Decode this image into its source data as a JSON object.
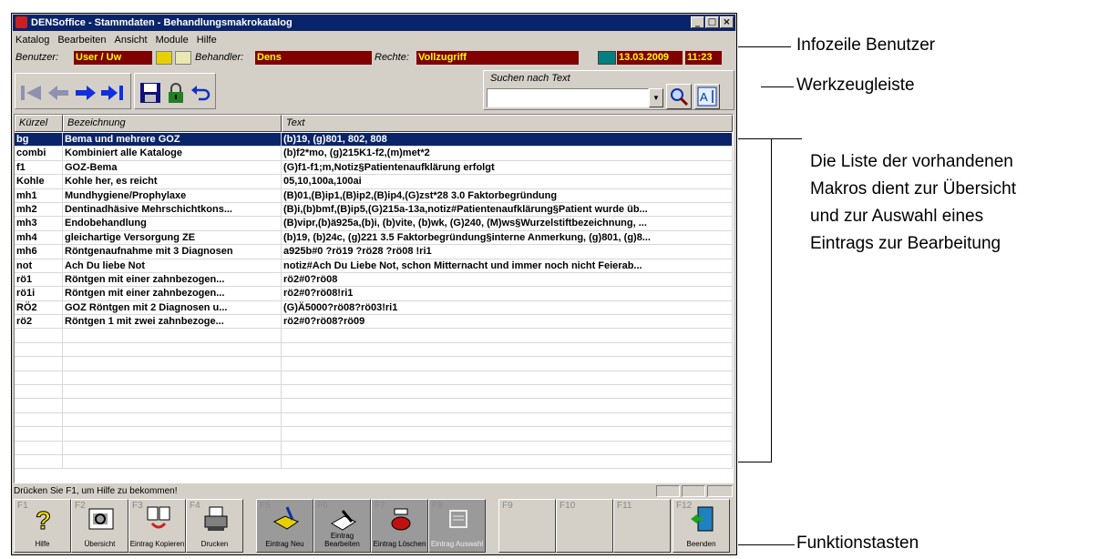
{
  "window": {
    "title": "DENSoffice - Stammdaten - Behandlungsmakrokatalog",
    "controls": [
      "_",
      "□",
      "×"
    ]
  },
  "menu": [
    "Katalog",
    "Bearbeiten",
    "Ansicht",
    "Module",
    "Hilfe"
  ],
  "infobar": {
    "benutzer_label": "Benutzer:",
    "benutzer_value": "User / Uw",
    "behandler_label": "Behandler:",
    "behandler_value": "Dens",
    "rechte_label": "Rechte:",
    "rechte_value": "Vollzugriff",
    "date": "13.03.2009",
    "time": "11:23"
  },
  "toolbar": {
    "search_label": "Suchen nach Text",
    "search_value": ""
  },
  "grid": {
    "columns": [
      "Kürzel",
      "Bezeichnung",
      "Text"
    ],
    "rows": [
      [
        "bg",
        "Bema und mehrere GOZ",
        "(b)19, (g)801, 802, 808"
      ],
      [
        "combi",
        "Kombiniert alle Kataloge",
        "(b)f2*mo, (g)215K1-f2,(m)met*2"
      ],
      [
        "f1",
        "GOZ-Bema",
        "(G)f1-f1;m,Notiz§Patientenaufklärung erfolgt"
      ],
      [
        "Kohle",
        "Kohle her, es reicht",
        "05,10,100a,100ai"
      ],
      [
        "mh1",
        "Mundhygiene/Prophylaxe",
        "(B)01,(B)ip1,(B)ip2,(B)ip4,(G)zst*28 3.0 Faktorbegründung"
      ],
      [
        "mh2",
        "Dentinadhäsive Mehrschichtkons...",
        "(B)i,(b)bmf,(B)ip5,(G)215a-13a,notiz#Patientenaufklärung§Patient wurde üb..."
      ],
      [
        "mh3",
        "Endobehandlung",
        "(B)vipr,(b)ä925a,(b)i, (b)vite, (b)wk, (G)240, (M)ws§Wurzelstiftbezeichnung, ..."
      ],
      [
        "mh4",
        "gleichartige Versorgung ZE",
        "(b)19, (b)24c, (g)221 3.5 Faktorbegründung§interne Anmerkung, (g)801, (g)8..."
      ],
      [
        "mh6",
        "Röntgenaufnahme mit 3 Diagnosen",
        "a925b#0 ?rö19 ?rö28  ?rö08 !ri1"
      ],
      [
        "not",
        "Ach Du liebe Not",
        "notiz#Ach Du Liebe Not, schon Mitternacht und immer noch nicht Feierab..."
      ],
      [
        "rö1",
        "Röntgen mit einer zahnbezogen...",
        "rö2#0?rö08"
      ],
      [
        "rö1i",
        "Röntgen mit einer zahnbezogen...",
        "rö2#0?rö08!ri1"
      ],
      [
        "RÖ2",
        "GOZ Röntgen mit 2 Diagnosen u...",
        "(G)Ä5000?rö08?rö03!ri1"
      ],
      [
        "rö2",
        "Röntgen 1 mit zwei zahnbezoge...",
        "rö2#0?rö08?rö09"
      ]
    ],
    "empty_rows": 10
  },
  "status": {
    "text": "Drücken Sie F1, um Hilfe zu bekommen!"
  },
  "fkeys": [
    {
      "num": "F1",
      "label": "Hilfe",
      "icon": "help-icon"
    },
    {
      "num": "F2",
      "label": "Übersicht",
      "icon": "overview-icon"
    },
    {
      "num": "F3",
      "label": "Eintrag Kopieren",
      "icon": "copy-icon"
    },
    {
      "num": "F4",
      "label": "Drucken",
      "icon": "printer-icon"
    },
    {
      "num": "F5",
      "label": "Eintrag Neu",
      "icon": "new-entry-icon"
    },
    {
      "num": "F6",
      "label": "Eintrag Bearbeiten",
      "icon": "edit-icon"
    },
    {
      "num": "F7",
      "label": "Eintrag Löschen",
      "icon": "delete-icon"
    },
    {
      "num": "F8",
      "label": "Eintrag Auswahl",
      "icon": "select-icon"
    },
    {
      "num": "F9",
      "label": "",
      "icon": ""
    },
    {
      "num": "F10",
      "label": "",
      "icon": ""
    },
    {
      "num": "F11",
      "label": "",
      "icon": ""
    },
    {
      "num": "F12",
      "label": "Beenden",
      "icon": "exit-icon"
    }
  ],
  "annotations": {
    "infozeile": "Infozeile Benutzer",
    "werkzeug": "Werkzeugleiste",
    "liste": [
      "Die Liste der vorhandenen",
      "Makros dient zur Übersicht",
      "und zur Auswahl eines",
      "Eintrags zur Bearbeitung"
    ],
    "funktion": "Funktionstasten"
  },
  "colors": {
    "titlebar": "#0a246a",
    "info_bg": "#800000",
    "info_fg": "#ffff00",
    "selection": "#0a246a",
    "window": "#d4d0c8"
  }
}
